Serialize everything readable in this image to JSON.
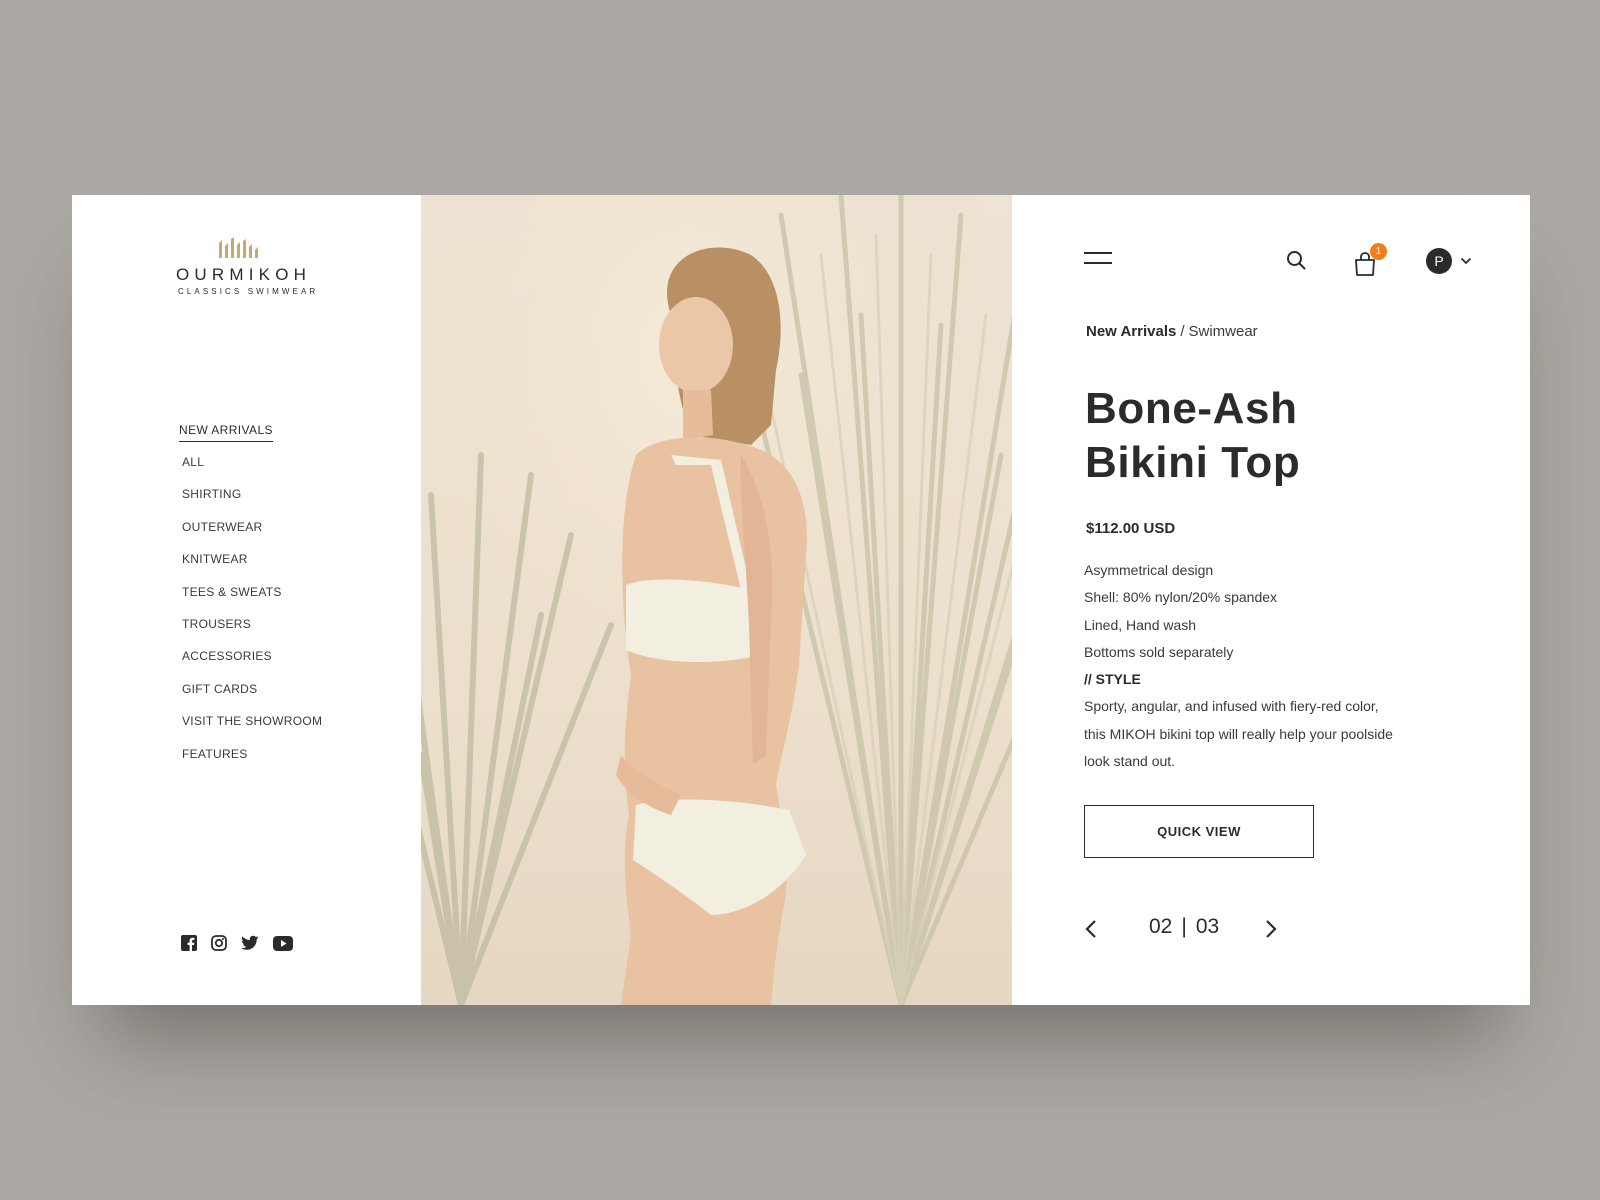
{
  "brand": {
    "name": "OURMIKOH",
    "tagline": "CLASSICS SWIMWEAR",
    "accent_color": "#c8a774"
  },
  "nav": {
    "heading": "NEW ARRIVALS",
    "items": [
      "ALL",
      "SHIRTING",
      "OUTERWEAR",
      "KNITWEAR",
      "TEES & SWEATS",
      "TROUSERS",
      "ACCESSORIES",
      "GIFT CARDS",
      "VISIT THE SHOWROOM",
      "FEATURES"
    ]
  },
  "social": [
    "facebook-icon",
    "instagram-icon",
    "twitter-icon",
    "youtube-icon"
  ],
  "header": {
    "menu_icon": "hamburger-menu-icon",
    "search_icon": "search-icon",
    "cart_icon": "shopping-bag-icon",
    "cart_count": "1",
    "cart_badge_color": "#f07d1a",
    "avatar_initial": "P"
  },
  "breadcrumb": {
    "parent": "New Arrivals",
    "separator": "/",
    "current": "Swimwear"
  },
  "product": {
    "title_line1": "Bone-Ash",
    "title_line2": "Bikini Top",
    "price": "$112.00 USD",
    "details": [
      "Asymmetrical design",
      "Shell: 80% nylon/20% spandex",
      "Lined, Hand wash",
      "Bottoms sold separately"
    ],
    "style_heading": "// STYLE",
    "style_text": "Sporty, angular, and infused with fiery-red color, this MIKOH bikini top will really help your poolside look stand out.",
    "cta": "QUICK VIEW"
  },
  "pager": {
    "current": "02",
    "separator": "|",
    "total": "03"
  },
  "colors": {
    "backdrop": "#aca8a3",
    "text": "#2b2b2b",
    "card": "#ffffff"
  }
}
